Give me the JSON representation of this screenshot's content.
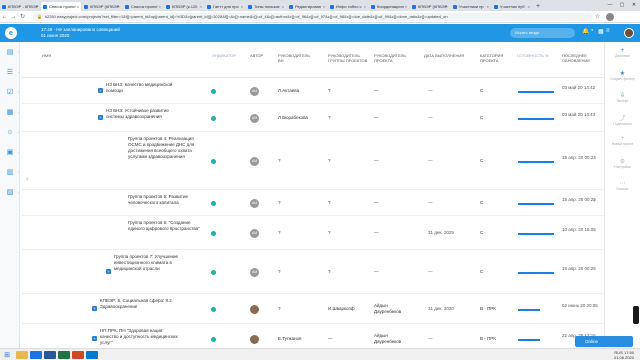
{
  "browser": {
    "tabs": [
      {
        "label": "КПВЭР - КПВЭР"
      },
      {
        "label": "Список проект"
      },
      {
        "label": "КПВЭР (КПВЭР"
      },
      {
        "label": "Список проект"
      },
      {
        "label": "КПВЭР (к.120"
      },
      {
        "label": "Гантт для про"
      },
      {
        "label": "Типы пользов"
      },
      {
        "label": "Редактирован"
      },
      {
        "label": "Инфо табло с"
      },
      {
        "label": "Координацион"
      },
      {
        "label": "КПВЭР (КПВЭР"
      },
      {
        "label": "Участники пр"
      },
      {
        "label": "Участник пуб"
      }
    ],
    "new_tab": "+",
    "url": "k2250.easyproject.com/projects?set_filter=1&f[]=parent_id&op[parent_id]=%3D&v[parent_id][]=3028&f[]=&c[]=name&c[]=cf_4&c[]=author&c[]=cf_96&c[]=cf_97&c[]=cf_98&c[]=due_date&c[]=cf_99&c[]=done_ratio&c[]=updated_on"
  },
  "header": {
    "time": "17:49 · Не запланировано совещаний",
    "date": "01 июня 2020",
    "search_placeholder": "Искать везде"
  },
  "columns": [
    "Имя",
    "Индикатор",
    "Автор",
    "Руководитель ВН",
    "Руководитель группы проектов",
    "Руководитель проекта",
    "Дата выполнения",
    "Категория проекта",
    "Готовность %",
    "Последнее обновление"
  ],
  "rows": [
    {
      "expand": "+",
      "name": "НЗ БНЗ: Качество медицинской помощи",
      "author": "AM",
      "vn": "Л.Актаева",
      "group": "?",
      "proj": "—",
      "due": "—",
      "cat": "С",
      "pct": 1.0,
      "updated": "03 май 20 14:42"
    },
    {
      "expand": "+",
      "name": "НЗ БНЗ: Устойчивое развитие системы здравоохранения",
      "author": "AM",
      "vn": "Л.Бюрабекова",
      "group": "?",
      "proj": "—",
      "due": "—",
      "cat": "С",
      "pct": 1.0,
      "updated": "03 май 20 14:43"
    },
    {
      "expand": "",
      "name": "Группа проектов 4: Реализация ОСМС и продвижение ДНС для достижения всеобщего охвата услугами здравоохранения",
      "author": "AM",
      "vn": "?",
      "group": "?",
      "proj": "—",
      "due": "—",
      "cat": "С",
      "pct": 1.0,
      "updated": "15 апр. 20 00:24"
    },
    {
      "expand": "",
      "name": "Группа проектов 5: Развитие человеческого капитала",
      "author": "AM",
      "vn": "?",
      "group": "?",
      "proj": "—",
      "due": "—",
      "cat": "С",
      "pct": 1.0,
      "updated": "15 апр. 20 00:25"
    },
    {
      "expand": "",
      "name": "Группа проектов 6: \"Создание единого цифрового пространства\"",
      "author": "AM",
      "vn": "?",
      "group": "?",
      "proj": "—",
      "due": "31 дек. 2025",
      "cat": "С",
      "pct": 1.0,
      "updated": "10 апр. 20 15:05"
    },
    {
      "expand": "+",
      "name": "Группа проектов 7: Улучшение инвестиционного климата в медицинской отрасли",
      "author": "AM",
      "vn": "?",
      "group": "?",
      "proj": "—",
      "due": "—",
      "cat": "С",
      "pct": 1.0,
      "updated": "15 апр. 20 00:25"
    },
    {
      "expand": "+",
      "name": "КПВЭР: 8. Социальная сфера: 8.2. Здравоохранение",
      "author": "photo",
      "vn": "?",
      "group": "И.Шваркопф",
      "proj": "Айдын Дауренбеков",
      "due": "31 дек. 2020",
      "cat": "В - ПРК",
      "pct": 0.6,
      "updated": "02 июнь 20 20:05"
    },
    {
      "expand": "+",
      "name": "НП ПРК: ПН \"Здоровая нация: качество и доступность медицинских услуг\"",
      "author": "photo",
      "vn": "Е.Тугжанов",
      "group": "—",
      "proj": "Айдын Дауренбеков",
      "due": "—",
      "cat": "В - ПРК",
      "pct": 0.6,
      "updated": "22 апр. 20 17:15"
    }
  ],
  "right_panel": [
    {
      "label": "Действия",
      "icon": "+"
    },
    {
      "label": "Сохран. фильтр",
      "icon": "★"
    },
    {
      "label": "Экспорт",
      "icon": "⇩"
    },
    {
      "label": "Поделиться",
      "icon": "⤴"
    },
    {
      "label": "Новый проект",
      "icon": "+"
    },
    {
      "label": "Настройки",
      "icon": "⚙"
    },
    {
      "label": "Больше",
      "icon": "⋯"
    }
  ],
  "online_label": "Online",
  "tray": {
    "lang": "RUS",
    "time": "17:50",
    "date": "01.06.2020"
  }
}
